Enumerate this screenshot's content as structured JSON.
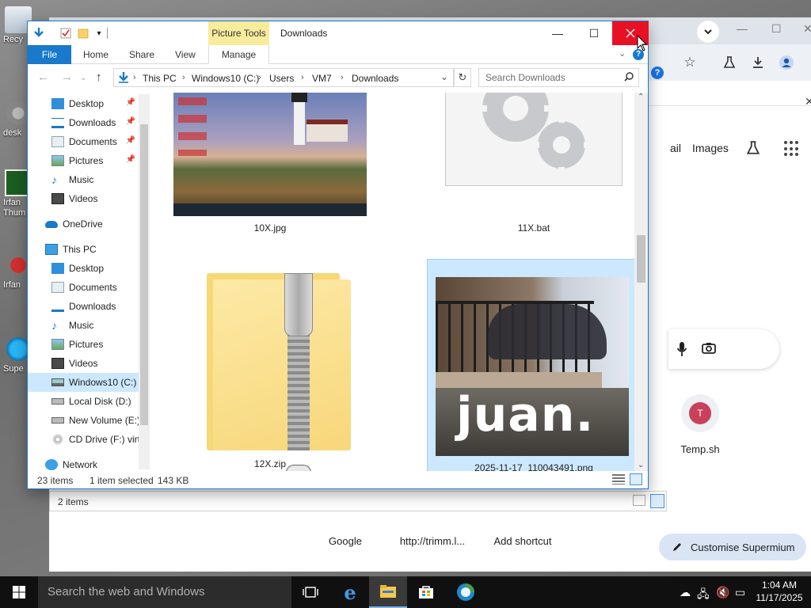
{
  "desktop": {
    "icons": [
      {
        "label": "Recy"
      },
      {
        "label": "desk"
      },
      {
        "label": "Irfan Thum"
      },
      {
        "label": "Irfan"
      },
      {
        "label": "Supe"
      }
    ]
  },
  "browser": {
    "top_links": {
      "mail": "ail",
      "images": "Images"
    },
    "shortcuts": [
      {
        "label": "Temp.sh",
        "letter": "T"
      },
      {
        "label": "Google"
      },
      {
        "label": "http://trimm.l..."
      },
      {
        "label": "Add shortcut"
      }
    ],
    "customise_label": "Customise Supermium",
    "status_items": "2 items"
  },
  "explorer": {
    "context_tab": "Picture Tools",
    "title": "Downloads",
    "ribbon_tabs": [
      "File",
      "Home",
      "Share",
      "View",
      "Manage"
    ],
    "breadcrumb": [
      "This PC",
      "Windows10 (C:)",
      "Users",
      "VM7",
      "Downloads"
    ],
    "search_placeholder": "Search Downloads",
    "nav": {
      "quick_access": [
        "Desktop",
        "Downloads",
        "Documents",
        "Pictures",
        "Music",
        "Videos"
      ],
      "onedrive": "OneDrive",
      "this_pc": "This PC",
      "this_pc_items": [
        "Desktop",
        "Documents",
        "Downloads",
        "Music",
        "Pictures",
        "Videos",
        "Windows10 (C:)",
        "Local Disk (D:)",
        "New Volume (E:)",
        "CD Drive (F:) virt"
      ],
      "network": "Network"
    },
    "files": [
      {
        "name": "10X.jpg"
      },
      {
        "name": "11X.bat"
      },
      {
        "name": "12X.zip"
      },
      {
        "name": "2025-11-17_110043491.png",
        "selected": true,
        "image_text": "juan."
      }
    ],
    "status": {
      "count": "23 items",
      "selected": "1 item selected",
      "size": "143 KB"
    }
  },
  "taskbar": {
    "search_placeholder": "Search the web and Windows",
    "time": "1:04 AM",
    "date": "11/17/2025"
  },
  "colors": {
    "accent": "#1979ca",
    "close_red": "#e81123",
    "selection": "#cce8ff"
  }
}
